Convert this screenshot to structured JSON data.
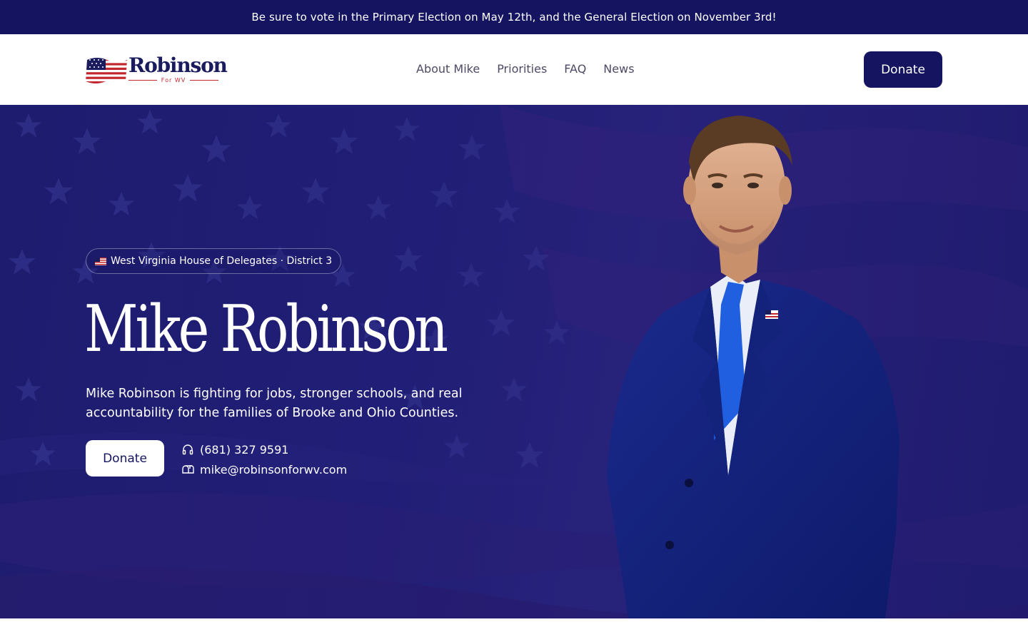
{
  "announcement": "Be sure to vote in the Primary Election on May 12th, and the General Election on November 3rd!",
  "logo": {
    "name": "Robinson",
    "sub": "For WV"
  },
  "nav": [
    "About Mike",
    "Priorities",
    "FAQ",
    "News"
  ],
  "header_donate": "Donate",
  "hero": {
    "badge": "West Virginia House of Delegates · District 3",
    "title": "Mike Robinson",
    "description": "Mike Robinson is fighting for jobs, stronger schools, and real accountability for the families of Brooke and Ohio Counties.",
    "donate": "Donate",
    "phone": "(681) 327 9591",
    "email": "mike@robinsonforwv.com"
  },
  "colors": {
    "navy": "#141460",
    "hero": "#211f78",
    "red": "#c1272d"
  },
  "icons": {
    "phone": "headphones-icon",
    "email": "mailbox-icon",
    "flag": "us-flag-icon"
  }
}
